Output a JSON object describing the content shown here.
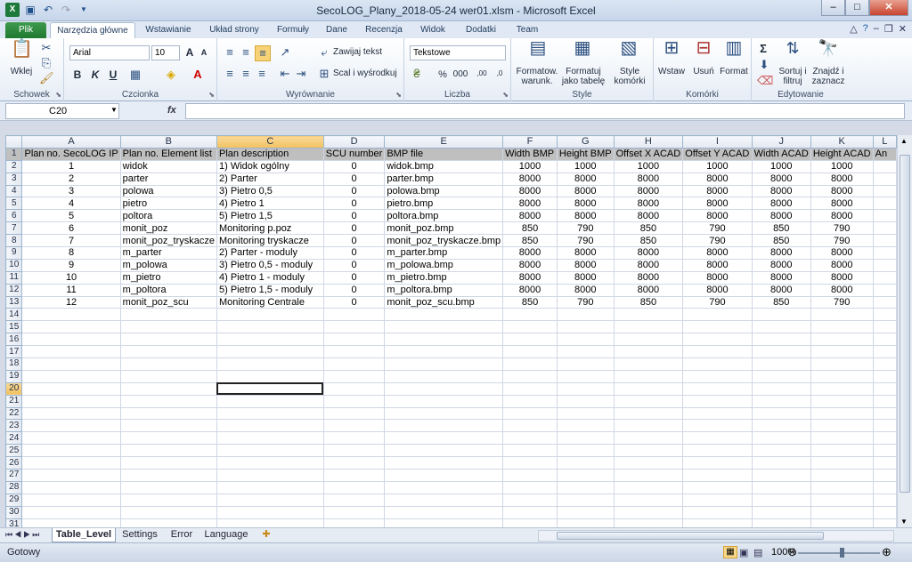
{
  "window": {
    "title": "SecoLOG_Plany_2018-05-24 wer01.xlsm - Microsoft Excel",
    "qat_icons": [
      "excel-icon",
      "save-icon",
      "undo-icon",
      "redo-icon"
    ],
    "buttons": {
      "minimize": "–",
      "maximize": "□",
      "close": "✕"
    }
  },
  "ribbon_tabs": [
    "Plik",
    "Narzędzia główne",
    "Wstawianie",
    "Układ strony",
    "Formuły",
    "Dane",
    "Recenzja",
    "Widok",
    "Dodatki",
    "Team"
  ],
  "ribbon": {
    "clipboard": {
      "paste": "Wklej",
      "label": "Schowek"
    },
    "font": {
      "name": "Arial",
      "size": "10",
      "bold": "B",
      "italic": "K",
      "underline": "U",
      "grow": "A",
      "shrink": "A",
      "label": "Czcionka"
    },
    "alignment": {
      "wrap": "Zawijaj tekst",
      "merge": "Scal i wyśrodkuj",
      "label": "Wyrównanie"
    },
    "number": {
      "format": "Tekstowe",
      "percent": "%",
      "thousands": "000",
      "inc_dec": ",00",
      "dec_dec": ",0",
      "label": "Liczba"
    },
    "styles": {
      "cond_l1": "Formatow.",
      "cond_l2": "warunk.",
      "table_l1": "Formatuj",
      "table_l2": "jako tabelę",
      "cell_l1": "Style",
      "cell_l2": "komórki",
      "label": "Style"
    },
    "cells": {
      "insert": "Wstaw",
      "delete": "Usuń",
      "format": "Format",
      "label": "Komórki"
    },
    "editing": {
      "sigma": "Σ",
      "sort_l1": "Sortuj i",
      "sort_l2": "filtruj",
      "find_l1": "Znajdź i",
      "find_l2": "zaznacz",
      "label": "Edytowanie"
    }
  },
  "formula_bar": {
    "name_box": "C20",
    "fx": "fx",
    "value": ""
  },
  "columns": [
    "A",
    "B",
    "C",
    "D",
    "E",
    "F",
    "G",
    "H",
    "I",
    "J",
    "K",
    "L"
  ],
  "selected_column": "C",
  "selected_row": 20,
  "header_row": [
    "Plan no. SecoLOG IP",
    "Plan no. Element list",
    "Plan description",
    "SCU number",
    "BMP file",
    "Width BMP",
    "Height BMP",
    "Offset X ACAD",
    "Offset Y ACAD",
    "Width ACAD",
    "Height ACAD",
    "An"
  ],
  "rows": [
    [
      "1",
      "widok",
      "1) Widok ogólny",
      "0",
      "widok.bmp",
      "1000",
      "1000",
      "1000",
      "1000",
      "1000",
      "1000"
    ],
    [
      "2",
      "parter",
      "2) Parter",
      "0",
      "parter.bmp",
      "8000",
      "8000",
      "8000",
      "8000",
      "8000",
      "8000"
    ],
    [
      "3",
      "polowa",
      "3) Pietro 0,5",
      "0",
      "polowa.bmp",
      "8000",
      "8000",
      "8000",
      "8000",
      "8000",
      "8000"
    ],
    [
      "4",
      "pietro",
      "4) Pietro 1",
      "0",
      "pietro.bmp",
      "8000",
      "8000",
      "8000",
      "8000",
      "8000",
      "8000"
    ],
    [
      "5",
      "poltora",
      "5) Pietro 1,5",
      "0",
      "poltora.bmp",
      "8000",
      "8000",
      "8000",
      "8000",
      "8000",
      "8000"
    ],
    [
      "6",
      "monit_poz",
      "Monitoring p.poz",
      "0",
      "monit_poz.bmp",
      "850",
      "790",
      "850",
      "790",
      "850",
      "790"
    ],
    [
      "7",
      "monit_poz_tryskacze",
      "Monitoring tryskacze",
      "0",
      "monit_poz_tryskacze.bmp",
      "850",
      "790",
      "850",
      "790",
      "850",
      "790"
    ],
    [
      "8",
      "m_parter",
      "2) Parter - moduly",
      "0",
      "m_parter.bmp",
      "8000",
      "8000",
      "8000",
      "8000",
      "8000",
      "8000"
    ],
    [
      "9",
      "m_polowa",
      "3) Pietro 0,5 - moduly",
      "0",
      "m_polowa.bmp",
      "8000",
      "8000",
      "8000",
      "8000",
      "8000",
      "8000"
    ],
    [
      "10",
      "m_pietro",
      "4) Pietro 1 - moduly",
      "0",
      "m_pietro.bmp",
      "8000",
      "8000",
      "8000",
      "8000",
      "8000",
      "8000"
    ],
    [
      "11",
      "m_poltora",
      "5) Pietro 1,5 - moduly",
      "0",
      "m_poltora.bmp",
      "8000",
      "8000",
      "8000",
      "8000",
      "8000",
      "8000"
    ],
    [
      "12",
      "monit_poz_scu",
      "Monitoring Centrale",
      "0",
      "monit_poz_scu.bmp",
      "850",
      "790",
      "850",
      "790",
      "850",
      "790"
    ]
  ],
  "total_rows_shown": 31,
  "sheet_tabs": [
    "Table_Level",
    "Settings",
    "Error",
    "Language"
  ],
  "active_sheet": "Table_Level",
  "status": {
    "ready": "Gotowy",
    "zoom": "100%"
  }
}
